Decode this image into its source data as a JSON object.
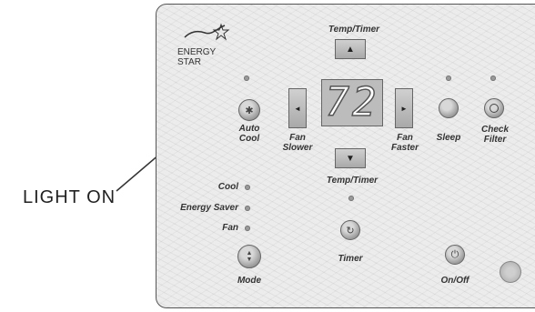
{
  "callout": {
    "label": "LIGHT ON"
  },
  "branding": {
    "logo_alt": "energy-star-logo",
    "label": "ENERGY STAR"
  },
  "display": {
    "temperature": "72"
  },
  "labels": {
    "temp_timer_top": "Temp/Timer",
    "temp_timer_bottom": "Temp/Timer",
    "auto": "Auto",
    "cool": "Cool",
    "fan_slower_1": "Fan",
    "fan_slower_2": "Slower",
    "fan_faster_1": "Fan",
    "fan_faster_2": "Faster",
    "sleep": "Sleep",
    "check": "Check",
    "filter": "Filter",
    "mode_cool": "Cool",
    "mode_energy_saver": "Energy Saver",
    "mode_fan": "Fan",
    "mode": "Mode",
    "timer": "Timer",
    "on_off": "On/Off"
  },
  "icons": {
    "up": "▲",
    "down": "▼",
    "left": "◄",
    "right": "►",
    "power": "⏻",
    "timer": "↻",
    "mode": "▲▼",
    "auto_cool": "✱"
  }
}
